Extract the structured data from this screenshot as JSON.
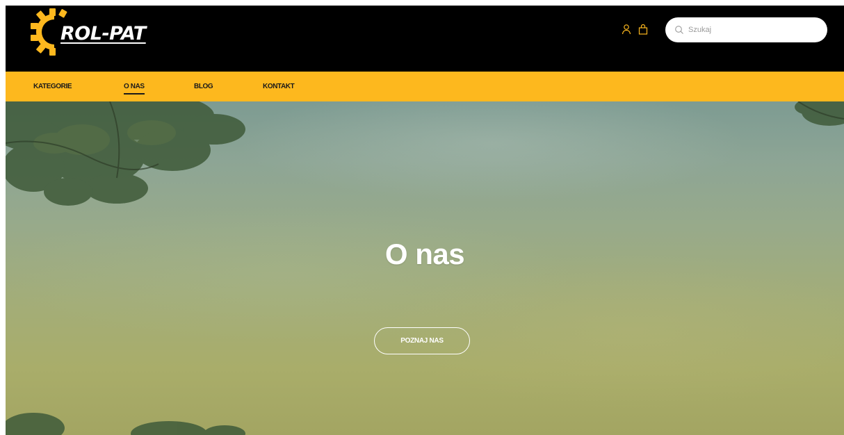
{
  "brand": {
    "name": "ROL-PAT",
    "logo_icon": "gear-icon",
    "accent_color": "#fdb81e"
  },
  "header": {
    "icons": [
      "user-icon",
      "bag-icon"
    ],
    "search": {
      "placeholder": "Szukaj",
      "icon": "search-icon"
    }
  },
  "nav": {
    "items": [
      {
        "label": "KATEGORIE"
      },
      {
        "label": "O NAS",
        "active": true
      },
      {
        "label": "BLOG"
      },
      {
        "label": "KONTAKT"
      }
    ]
  },
  "hero": {
    "title": "O nas",
    "button_label": "POZNAJ NAS"
  }
}
